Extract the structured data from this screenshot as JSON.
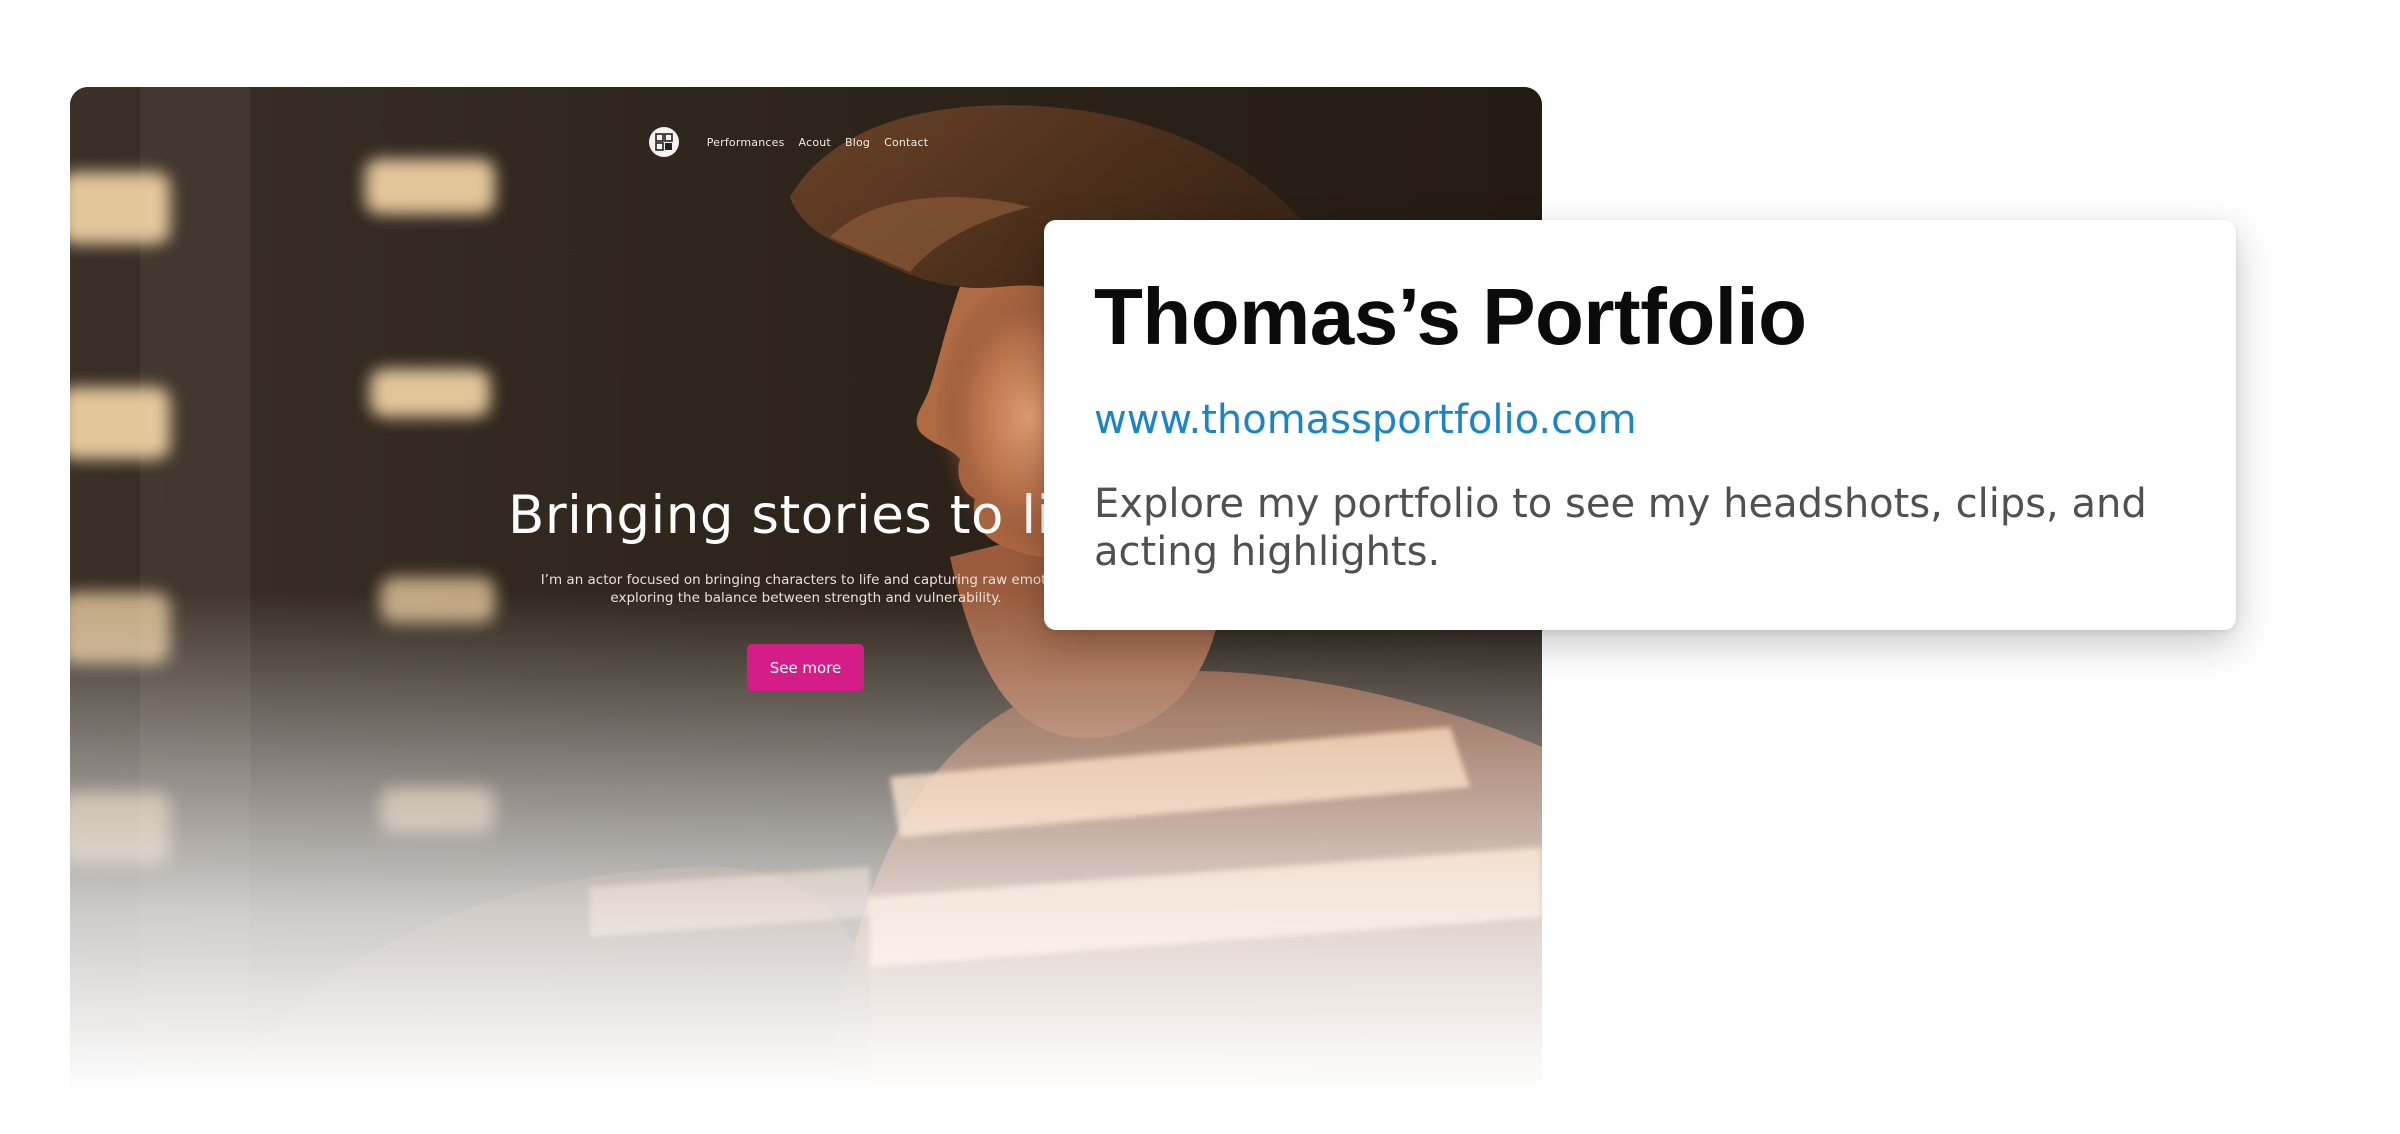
{
  "site": {
    "nav": {
      "links": [
        "Performances",
        "Acout",
        "Blog",
        "Contact"
      ]
    },
    "hero": {
      "title": "Bringing stories to life",
      "text_line1": "I’m an actor focused on bringing characters to life and capturing raw emotion,",
      "text_line2": "exploring the balance between strength and vulnerability.",
      "cta_label": "See more"
    },
    "colors": {
      "cta": "#d41d86",
      "background": "#2e241a"
    },
    "image": "portrait-photo"
  },
  "card": {
    "title": "Thomas’s Portfolio",
    "url": "www.thomassportfolio.com",
    "description": "Explore my portfolio to see my headshots, clips, and acting highlights.",
    "colors": {
      "url": "#1b84c6",
      "title": "#0b0b0b"
    }
  }
}
